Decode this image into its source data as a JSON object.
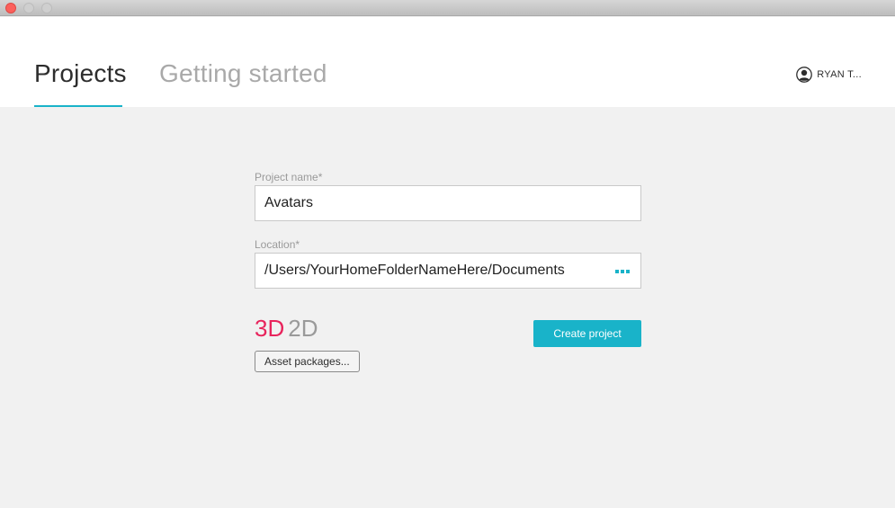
{
  "window": {
    "controls": [
      "close",
      "minimize",
      "maximize"
    ]
  },
  "header": {
    "tabs": [
      {
        "label": "Projects",
        "active": true
      },
      {
        "label": "Getting started",
        "active": false
      }
    ],
    "user": {
      "name": "RYAN T...",
      "icon": "user-avatar-icon"
    }
  },
  "form": {
    "project_name": {
      "label": "Project name*",
      "value": "Avatars"
    },
    "location": {
      "label": "Location*",
      "value": "/Users/YourHomeFolderNameHere/Documents",
      "browse_icon": "more-dots-icon"
    },
    "dimension": {
      "options": [
        "3D",
        "2D"
      ],
      "selected": "3D"
    },
    "asset_packages_label": "Asset packages...",
    "create_label": "Create project"
  },
  "colors": {
    "accent": "#19b3c9",
    "selected_dimension": "#e8245c",
    "muted_text": "#a9a9a9"
  }
}
